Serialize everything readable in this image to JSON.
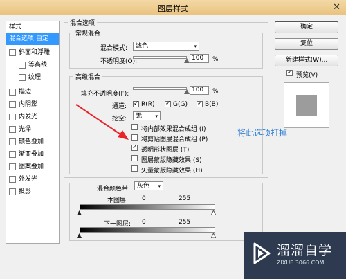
{
  "window": {
    "title": "图层样式",
    "close_glyph": "✕"
  },
  "left_panel": {
    "header": "样式",
    "items": [
      {
        "label": "混合选项:自定",
        "checkbox": false,
        "selected": true
      },
      {
        "label": "斜面和浮雕",
        "checkbox": true
      },
      {
        "label": "等高线",
        "checkbox": true
      },
      {
        "label": "纹理",
        "checkbox": true
      },
      {
        "label": "描边",
        "checkbox": true
      },
      {
        "label": "内阴影",
        "checkbox": true
      },
      {
        "label": "内发光",
        "checkbox": true
      },
      {
        "label": "光泽",
        "checkbox": true
      },
      {
        "label": "颜色叠加",
        "checkbox": true
      },
      {
        "label": "渐变叠加",
        "checkbox": true
      },
      {
        "label": "图案叠加",
        "checkbox": true
      },
      {
        "label": "外发光",
        "checkbox": true
      },
      {
        "label": "投影",
        "checkbox": true
      }
    ]
  },
  "blend_options": {
    "title": "混合选项",
    "general": {
      "title": "常规混合",
      "mode_label": "混合模式:",
      "mode_value": "滤色",
      "opacity_label": "不透明度(O):",
      "opacity_value": "100",
      "opacity_unit": "%",
      "opacity_level": 1.0
    },
    "advanced": {
      "title": "高级混合",
      "fill_label": "填充不透明度(F):",
      "fill_value": "100",
      "fill_unit": "%",
      "fill_level": 1.0,
      "channels_label": "通道:",
      "channels": [
        {
          "label": "R(R)",
          "checked": true
        },
        {
          "label": "G(G)",
          "checked": true
        },
        {
          "label": "B(B)",
          "checked": true
        }
      ],
      "knockout_label": "挖空:",
      "knockout_value": "无",
      "options": [
        {
          "label": "将内部效果混合成组 (I)",
          "checked": false
        },
        {
          "label": "将剪贴图层混合成组 (P)",
          "checked": false
        },
        {
          "label": "透明形状图层 (T)",
          "checked": true
        },
        {
          "label": "图层蒙版隐藏效果 (S)",
          "checked": false
        },
        {
          "label": "矢量蒙版隐藏效果 (H)",
          "checked": false
        }
      ]
    },
    "blend_if": {
      "label": "混合颜色带:",
      "value": "灰色",
      "this_layer_label": "本图层:",
      "this_layer_min": "0",
      "this_layer_max": "255",
      "under_layer_label": "下一图层:",
      "under_layer_min": "0",
      "under_layer_max": "255"
    }
  },
  "buttons": {
    "ok": "确定",
    "reset": "复位",
    "new_style": "新建样式(W)..."
  },
  "preview": {
    "label": "预览(V)",
    "checked": true
  },
  "annotation": {
    "text": "将此选项打掉",
    "color": "#2f7fd2",
    "arrow_color": "#e8232a"
  },
  "watermark": {
    "brand": "溜溜自学",
    "url": "ZIXUE.3066.COM"
  },
  "icons": {
    "dropdown": "▾",
    "check": "✓"
  },
  "colors": {
    "selection": "#3399ff",
    "titlebar": "#eccb8c"
  }
}
